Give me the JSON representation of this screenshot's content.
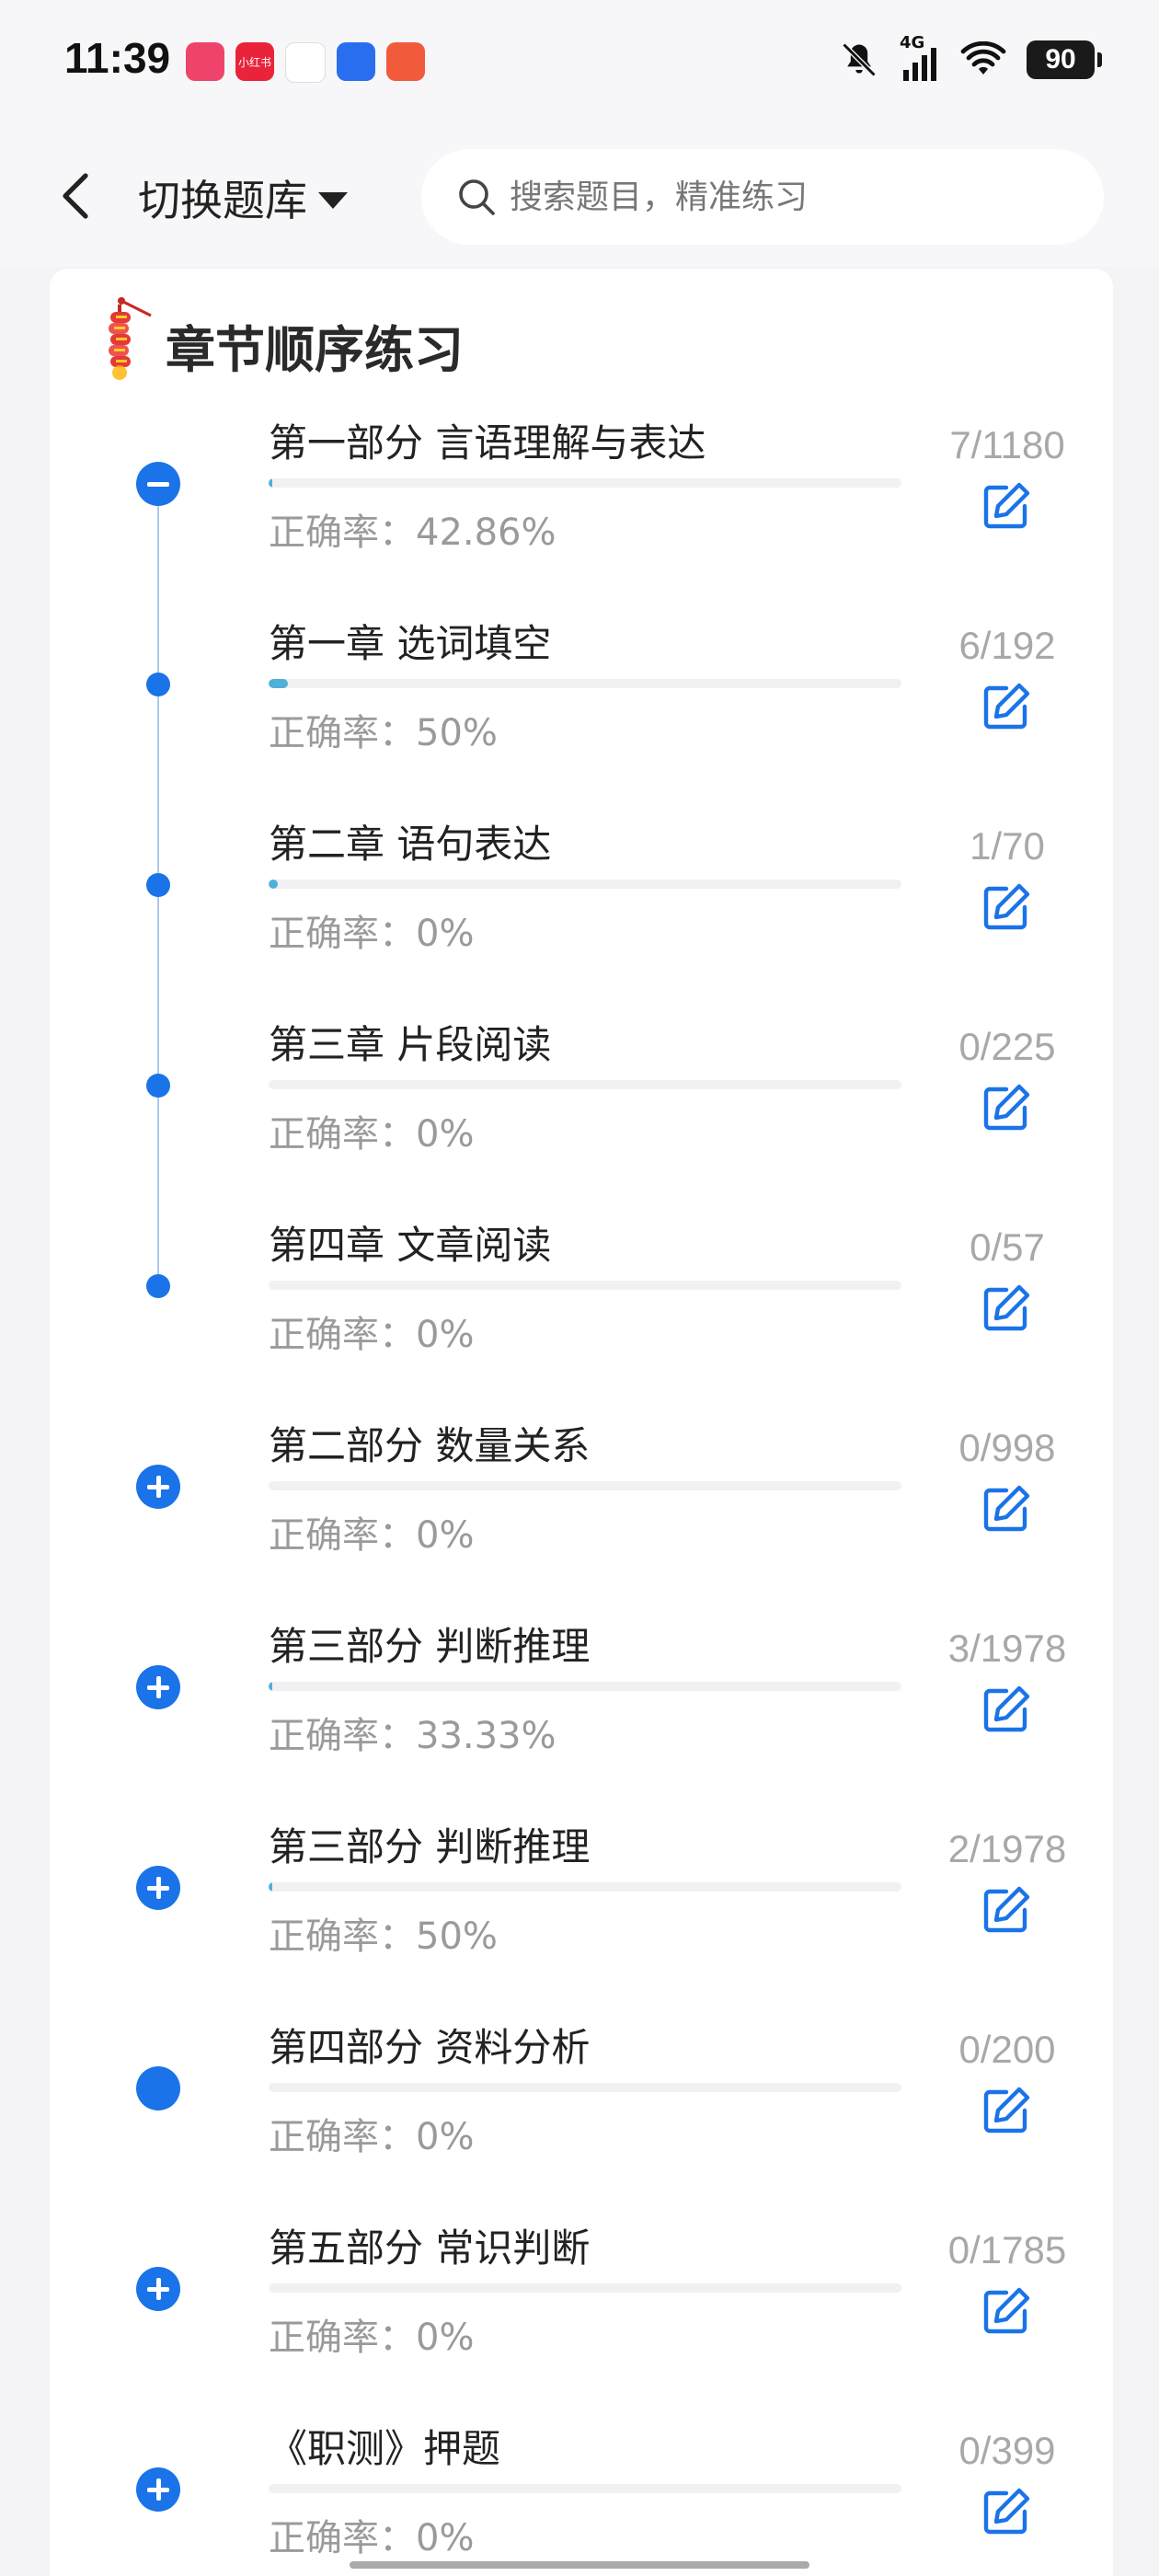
{
  "status_bar": {
    "time": "11:39",
    "network": "4G",
    "battery": "90",
    "app_icons": [
      {
        "name": "app-icon-1",
        "label": "",
        "color": "#f0436c"
      },
      {
        "name": "app-icon-2",
        "label": "小红书",
        "color": "#e9243a"
      },
      {
        "name": "app-icon-3",
        "label": "",
        "color": "#ffffff"
      },
      {
        "name": "app-icon-4",
        "label": "",
        "color": "#2a6ef0"
      },
      {
        "name": "app-icon-5",
        "label": "",
        "color": "#f25a3c"
      }
    ]
  },
  "header": {
    "switch_label": "切换题库",
    "search_placeholder": "搜索题目，精准练习"
  },
  "section": {
    "title": "章节顺序练习"
  },
  "chapters": [
    {
      "title": "第一部分 言语理解与表达",
      "accuracy": "正确率：42.86%",
      "count": "7/1180",
      "progress": 0.006,
      "node": "minus"
    },
    {
      "title": "第一章 选词填空",
      "accuracy": "正确率：50%",
      "count": "6/192",
      "progress": 0.031,
      "node": "dot"
    },
    {
      "title": "第二章 语句表达",
      "accuracy": "正确率：0%",
      "count": "1/70",
      "progress": 0.014,
      "node": "dot"
    },
    {
      "title": "第三章 片段阅读",
      "accuracy": "正确率：0%",
      "count": "0/225",
      "progress": 0,
      "node": "dot"
    },
    {
      "title": "第四章 文章阅读",
      "accuracy": "正确率：0%",
      "count": "0/57",
      "progress": 0,
      "node": "dot"
    },
    {
      "title": "第二部分 数量关系",
      "accuracy": "正确率：0%",
      "count": "0/998",
      "progress": 0,
      "node": "plus"
    },
    {
      "title": "第三部分 判断推理",
      "accuracy": "正确率：33.33%",
      "count": "3/1978",
      "progress": 0.0015,
      "node": "plus"
    },
    {
      "title": "第三部分 判断推理",
      "accuracy": "正确率：50%",
      "count": "2/1978",
      "progress": 0.001,
      "node": "plus"
    },
    {
      "title": "第四部分 资料分析",
      "accuracy": "正确率：0%",
      "count": "0/200",
      "progress": 0,
      "node": "filled"
    },
    {
      "title": "第五部分 常识判断",
      "accuracy": "正确率：0%",
      "count": "0/1785",
      "progress": 0,
      "node": "plus"
    },
    {
      "title": "《职测》押题",
      "accuracy": "正确率：0%",
      "count": "0/399",
      "progress": 0,
      "node": "plus"
    }
  ],
  "colors": {
    "accent": "#1a73e8",
    "progress": "#4fb0d9",
    "timeline": "#aac9ef"
  }
}
